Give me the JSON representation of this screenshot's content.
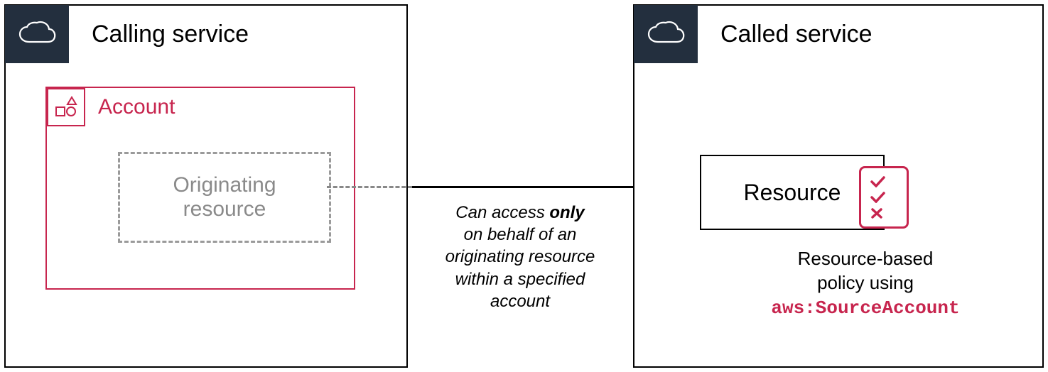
{
  "left_panel": {
    "title": "Calling service",
    "account_label": "Account",
    "orig_line1": "Originating",
    "orig_line2": "resource"
  },
  "caption": {
    "pre": "Can access ",
    "bold": "only",
    "line2": "on behalf of an",
    "line3": "originating resource",
    "line4": "within a specified",
    "line5": "account"
  },
  "right_panel": {
    "title": "Called service",
    "resource_label": "Resource",
    "policy_line1": "Resource-based",
    "policy_line2": "policy using",
    "policy_code": "aws:SourceAccount"
  },
  "colors": {
    "accent": "#c7254e",
    "dark": "#232f3e"
  }
}
